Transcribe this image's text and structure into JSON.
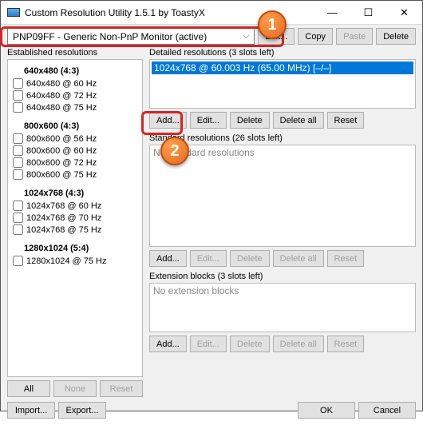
{
  "window": {
    "title": "Custom Resolution Utility 1.5.1 by ToastyX"
  },
  "winbtns": {
    "min": "—",
    "max": "☐",
    "close": "✕"
  },
  "monitor": {
    "selected": "PNP09FF - Generic Non-PnP Monitor (active)"
  },
  "topbtns": {
    "edit": "Edit...",
    "copy": "Copy",
    "paste": "Paste",
    "delete": "Delete"
  },
  "left": {
    "label": "Established resolutions",
    "groups": [
      {
        "head": "640x480 (4:3)",
        "items": [
          "640x480 @ 60 Hz",
          "640x480 @ 72 Hz",
          "640x480 @ 75 Hz"
        ]
      },
      {
        "head": "800x600 (4:3)",
        "items": [
          "800x600 @ 56 Hz",
          "800x600 @ 60 Hz",
          "800x600 @ 72 Hz",
          "800x600 @ 75 Hz"
        ]
      },
      {
        "head": "1024x768 (4:3)",
        "items": [
          "1024x768 @ 60 Hz",
          "1024x768 @ 70 Hz",
          "1024x768 @ 75 Hz"
        ]
      },
      {
        "head": "1280x1024 (5:4)",
        "items": [
          "1280x1024 @ 75 Hz"
        ]
      }
    ],
    "btns": {
      "all": "All",
      "none": "None",
      "reset": "Reset"
    }
  },
  "detailed": {
    "label": "Detailed resolutions (3 slots left)",
    "selected": "1024x768 @ 60.003 Hz (65.00 MHz) [–/–]",
    "btns": {
      "add": "Add...",
      "edit": "Edit...",
      "delete": "Delete",
      "deleteall": "Delete all",
      "reset": "Reset"
    }
  },
  "standard": {
    "label": "Standard resolutions (26 slots left)",
    "empty": "No standard resolutions",
    "btns": {
      "add": "Add...",
      "edit": "Edit...",
      "delete": "Delete",
      "deleteall": "Delete all",
      "reset": "Reset"
    }
  },
  "ext": {
    "label": "Extension blocks (3 slots left)",
    "empty": "No extension blocks",
    "btns": {
      "add": "Add...",
      "edit": "Edit...",
      "delete": "Delete",
      "deleteall": "Delete all",
      "reset": "Reset"
    }
  },
  "bottom": {
    "import": "Import...",
    "export": "Export...",
    "ok": "OK",
    "cancel": "Cancel"
  },
  "callouts": {
    "one": "1",
    "two": "2"
  }
}
